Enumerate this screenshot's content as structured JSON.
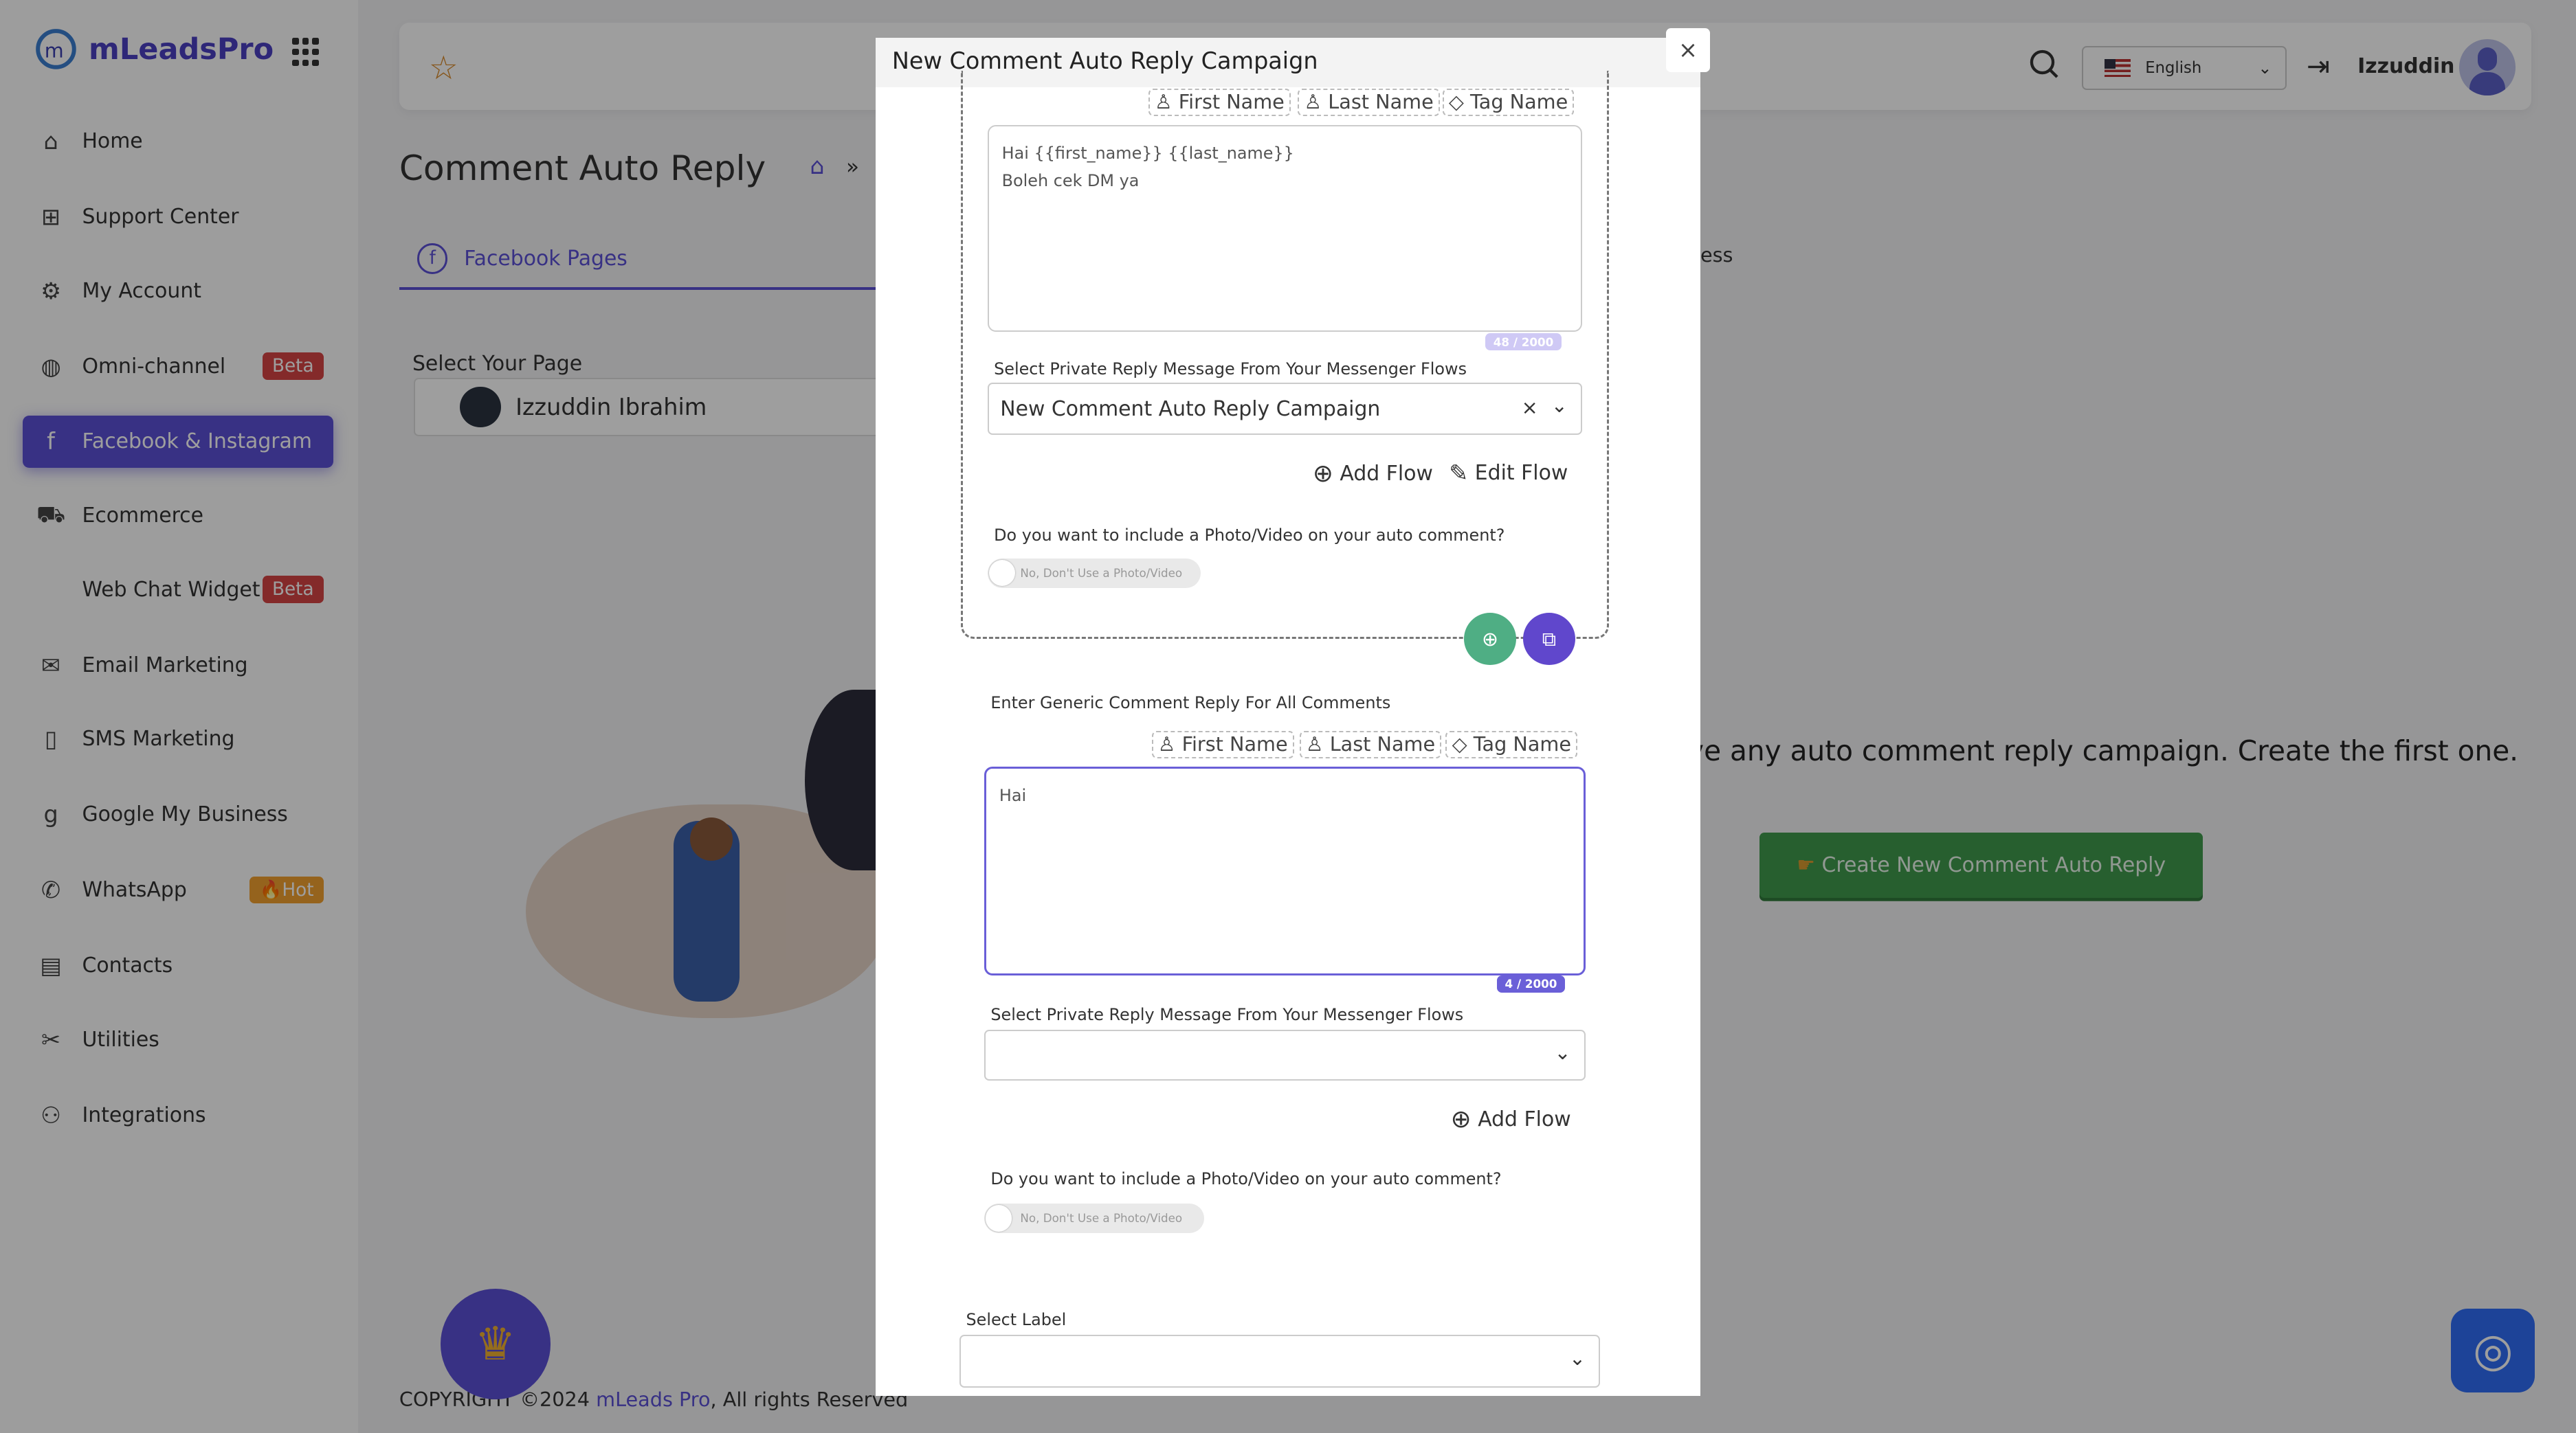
{
  "brand": {
    "name": "mLeadsPro"
  },
  "sidebar": {
    "items": [
      {
        "label": "Home",
        "icon": "home-icon"
      },
      {
        "label": "Support Center",
        "icon": "support-icon"
      },
      {
        "label": "My Account",
        "icon": "gear-icon"
      },
      {
        "label": "Omni-channel",
        "icon": "globe-icon",
        "badge": "Beta"
      },
      {
        "label": "Facebook & Instagram",
        "icon": "facebook-icon",
        "active": true
      },
      {
        "label": "Ecommerce",
        "icon": "cart-icon"
      },
      {
        "label": "Web Chat Widget",
        "icon": "code-icon",
        "badge": "Beta"
      },
      {
        "label": "Email Marketing",
        "icon": "mail-icon"
      },
      {
        "label": "SMS Marketing",
        "icon": "phone-icon"
      },
      {
        "label": "Google My Business",
        "icon": "google-icon"
      },
      {
        "label": "WhatsApp",
        "icon": "whatsapp-icon",
        "badge": "🔥Hot"
      },
      {
        "label": "Contacts",
        "icon": "book-icon"
      },
      {
        "label": "Utilities",
        "icon": "tools-icon"
      },
      {
        "label": "Integrations",
        "icon": "integrations-icon"
      }
    ]
  },
  "header": {
    "language": "English",
    "username": "Izzuddin"
  },
  "page": {
    "title": "Comment Auto Reply",
    "breadcrumb_sep": "»",
    "tab": "Facebook Pages",
    "tab_partial": "ess",
    "select_page_label": "Select Your Page",
    "selected_page": "Izzuddin Ibrahim",
    "empty_message": "ve any auto comment reply campaign. Create the first one.",
    "create_button": "Create New Comment Auto Reply",
    "footer_prefix": "COPYRIGHT ©2024 ",
    "footer_link": "mLeads Pro",
    "footer_suffix": ", All rights Reserved"
  },
  "modal": {
    "title": "New Comment Auto Reply Campaign",
    "close": "×",
    "chips": {
      "first": "First Name",
      "last": "Last Name",
      "tag": "Tag Name"
    },
    "block1": {
      "reply_line1": "Hai {{first_name}} {{last_name}}",
      "reply_line2": "Boleh cek DM ya",
      "counter": "48 / 2000",
      "flow_label": "Select Private Reply Message From Your Messenger Flows",
      "flow_value": "New Comment Auto Reply Campaign",
      "add_flow": "Add Flow",
      "edit_flow": "Edit Flow",
      "photo_question": "Do you want to include a Photo/Video on your auto comment?",
      "photo_toggle": "No, Don't Use a Photo/Video"
    },
    "generic": {
      "label": "Enter Generic Comment Reply For All Comments",
      "value": "Hai",
      "counter": "4 / 2000",
      "flow_label": "Select Private Reply Message From Your Messenger Flows",
      "flow_value": "",
      "add_flow": "Add Flow",
      "photo_question": "Do you want to include a Photo/Video on your auto comment?",
      "photo_toggle": "No, Don't Use a Photo/Video"
    },
    "select_label": "Select Label",
    "select_label_value": ""
  },
  "colors": {
    "accent": "#5b4fd6",
    "green": "#3f9a4d",
    "badge_red": "#d64545"
  }
}
